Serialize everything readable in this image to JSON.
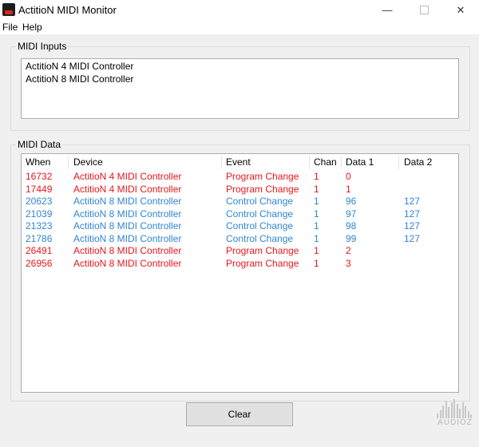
{
  "window": {
    "title": "ActitioN MIDI Monitor",
    "close_glyph": "✕",
    "minimize_glyph": "—"
  },
  "menu": {
    "items": [
      "File",
      "Help"
    ]
  },
  "inputs": {
    "label": "MIDI Inputs",
    "items": [
      "ActitioN 4 MIDI Controller",
      "ActitioN 8 MIDI Controller"
    ]
  },
  "data": {
    "label": "MIDI Data",
    "columns": [
      "When",
      "Device",
      "Event",
      "Chan",
      "Data 1",
      "Data 2"
    ],
    "colors": {
      "program": "#e8171c",
      "control": "#2f86d3"
    },
    "rows": [
      {
        "when": "16732",
        "device": "ActitioN 4 MIDI Controller",
        "event": "Program Change",
        "chan": "1",
        "d1": "0",
        "d2": "",
        "kind": "program"
      },
      {
        "when": "17449",
        "device": "ActitioN 4 MIDI Controller",
        "event": "Program Change",
        "chan": "1",
        "d1": "1",
        "d2": "",
        "kind": "program"
      },
      {
        "when": "20623",
        "device": "ActitioN 8 MIDI Controller",
        "event": "Control Change",
        "chan": "1",
        "d1": "96",
        "d2": "127",
        "kind": "control"
      },
      {
        "when": "21039",
        "device": "ActitioN 8 MIDI Controller",
        "event": "Control Change",
        "chan": "1",
        "d1": "97",
        "d2": "127",
        "kind": "control"
      },
      {
        "when": "21323",
        "device": "ActitioN 8 MIDI Controller",
        "event": "Control Change",
        "chan": "1",
        "d1": "98",
        "d2": "127",
        "kind": "control"
      },
      {
        "when": "21786",
        "device": "ActitioN 8 MIDI Controller",
        "event": "Control Change",
        "chan": "1",
        "d1": "99",
        "d2": "127",
        "kind": "control"
      },
      {
        "when": "26491",
        "device": "ActitioN 8 MIDI Controller",
        "event": "Program Change",
        "chan": "1",
        "d1": "2",
        "d2": "",
        "kind": "program"
      },
      {
        "when": "26956",
        "device": "ActitioN 8 MIDI Controller",
        "event": "Program Change",
        "chan": "1",
        "d1": "3",
        "d2": "",
        "kind": "program"
      }
    ]
  },
  "buttons": {
    "clear": "Clear"
  },
  "watermark": {
    "text": "AUDIOZ"
  }
}
